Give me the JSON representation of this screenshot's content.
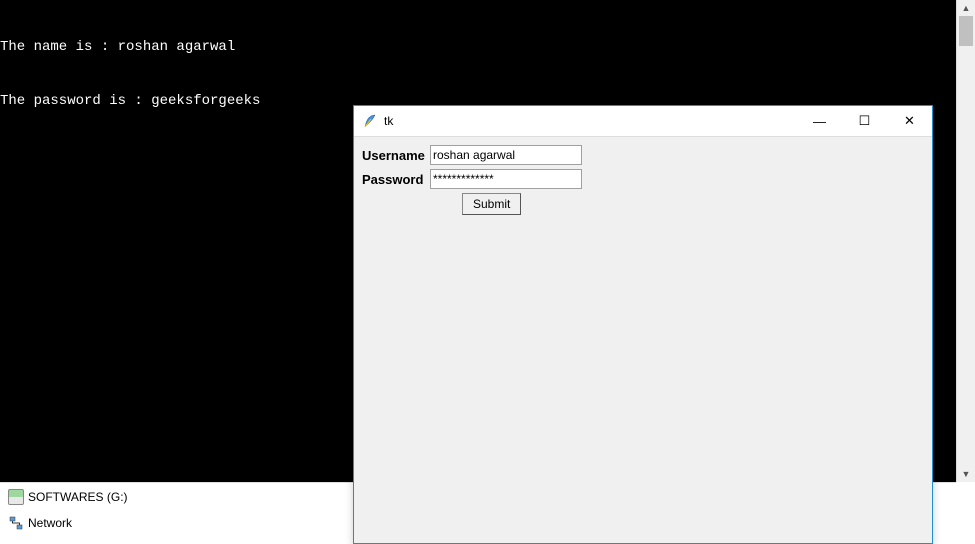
{
  "terminal": {
    "line1": "The name is : roshan agarwal",
    "line2": "The password is : geeksforgeeks"
  },
  "explorer": {
    "drive_label": "SOFTWARES (G:)",
    "network_label": "Network"
  },
  "tk": {
    "title": "tk",
    "username_label": "Username",
    "password_label": "Password",
    "username_value": "roshan agarwal",
    "password_value": "*************",
    "submit_label": "Submit",
    "minimize": "—",
    "maximize": "☐",
    "close": "✕"
  }
}
